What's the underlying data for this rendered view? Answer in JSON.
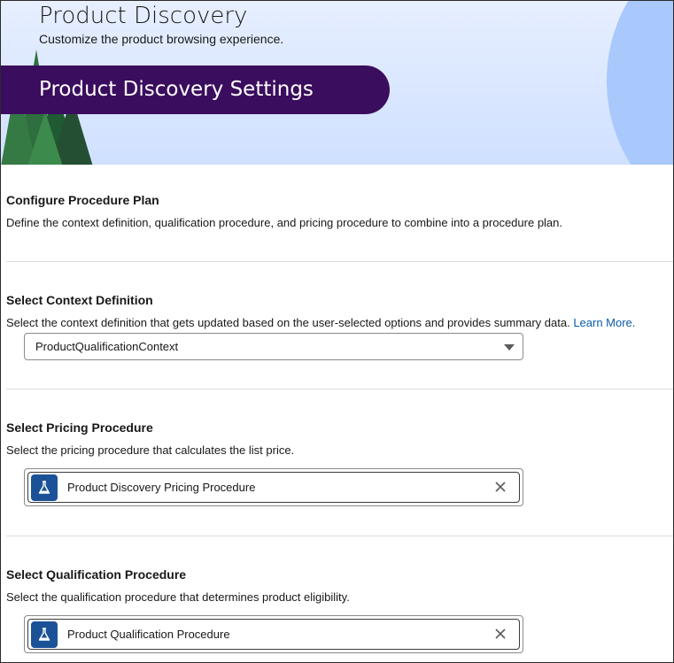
{
  "header": {
    "title": "Product Discovery",
    "subtitle": "Customize the product browsing experience.",
    "banner_title": "Product Discovery Settings"
  },
  "sections": {
    "procedure_plan": {
      "title": "Configure Procedure Plan",
      "description": "Define the context definition, qualification procedure, and pricing procedure to combine into a procedure plan."
    },
    "context_definition": {
      "title": "Select Context Definition",
      "description": "Select the context definition that gets updated based on the user-selected options and provides summary data.",
      "learn_more": "Learn More.",
      "selected_value": "ProductQualificationContext"
    },
    "pricing_procedure": {
      "title": "Select Pricing Procedure",
      "description": "Select the pricing procedure that calculates the list price.",
      "selected_value": "Product Discovery Pricing Procedure",
      "icon": "flask-icon"
    },
    "qualification_procedure": {
      "title": "Select Qualification Procedure",
      "description": "Select the qualification procedure that determines product eligibility.",
      "selected_value": "Product Qualification Procedure",
      "icon": "flask-icon"
    }
  },
  "colors": {
    "banner": "#3b0d5e",
    "link": "#0b5cab",
    "icon_bg": "#1b5297",
    "header_bg": "#dbe7ff",
    "header_circle": "#a9c8fb"
  }
}
